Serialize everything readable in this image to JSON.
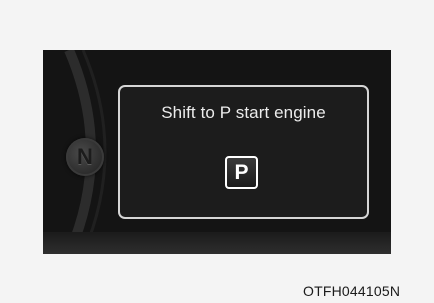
{
  "display": {
    "gear_indicator_label": "N",
    "message": "Shift to P start engine",
    "p_icon_label": "P"
  },
  "figure_code": "OTFH044105N",
  "icons": {
    "gear": "gear-n-indicator-icon",
    "park": "park-p-icon"
  },
  "colors": {
    "panel_background": "#141414",
    "message_border": "#d6d6d6",
    "text": "#ececec"
  }
}
